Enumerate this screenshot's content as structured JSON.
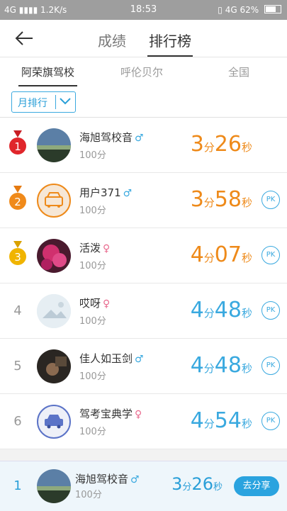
{
  "status_bar": {
    "network": "4G",
    "speed": "1.2K/s",
    "time": "18:53",
    "network_right": "4G",
    "battery": "62%"
  },
  "header": {
    "tabs": [
      "成绩",
      "排行榜"
    ],
    "active_tab": 1
  },
  "subtabs": {
    "items": [
      "阿荣旗驾校",
      "呼伦贝尔",
      "全国"
    ],
    "active": 0
  },
  "filter": {
    "selected": "月排行"
  },
  "colors": {
    "accent": "#2a9fd8",
    "orange": "#ee8a1a",
    "male": "#3aa9df",
    "female": "#e96a8e",
    "gold_medal": "#f0b400",
    "red_medal": "#e0262b"
  },
  "ranking": [
    {
      "rank": "1",
      "name": "海旭驾校音",
      "gender": "♂",
      "score": "100分",
      "min": "3",
      "min_unit": "分",
      "sec": "26",
      "sec_unit": "秒",
      "pk": ""
    },
    {
      "rank": "2",
      "name": "用户371",
      "gender": "♂",
      "score": "100分",
      "min": "3",
      "min_unit": "分",
      "sec": "58",
      "sec_unit": "秒",
      "pk": "PK"
    },
    {
      "rank": "3",
      "name": "活泼",
      "gender": "♀",
      "score": "100分",
      "min": "4",
      "min_unit": "分",
      "sec": "07",
      "sec_unit": "秒",
      "pk": "PK"
    },
    {
      "rank": "4",
      "name": "哎呀",
      "gender": "♀",
      "score": "100分",
      "min": "4",
      "min_unit": "分",
      "sec": "48",
      "sec_unit": "秒",
      "pk": "PK"
    },
    {
      "rank": "5",
      "name": "佳人如玉剑",
      "gender": "♂",
      "score": "100分",
      "min": "4",
      "min_unit": "分",
      "sec": "48",
      "sec_unit": "秒",
      "pk": "PK"
    },
    {
      "rank": "6",
      "name": "驾考宝典学",
      "gender": "♀",
      "score": "100分",
      "min": "4",
      "min_unit": "分",
      "sec": "54",
      "sec_unit": "秒",
      "pk": "PK"
    }
  ],
  "my_rank": {
    "rank": "1",
    "name": "海旭驾校音",
    "gender": "♂",
    "score": "100分",
    "min": "3",
    "min_unit": "分",
    "sec": "26",
    "sec_unit": "秒",
    "share": "去分享"
  }
}
